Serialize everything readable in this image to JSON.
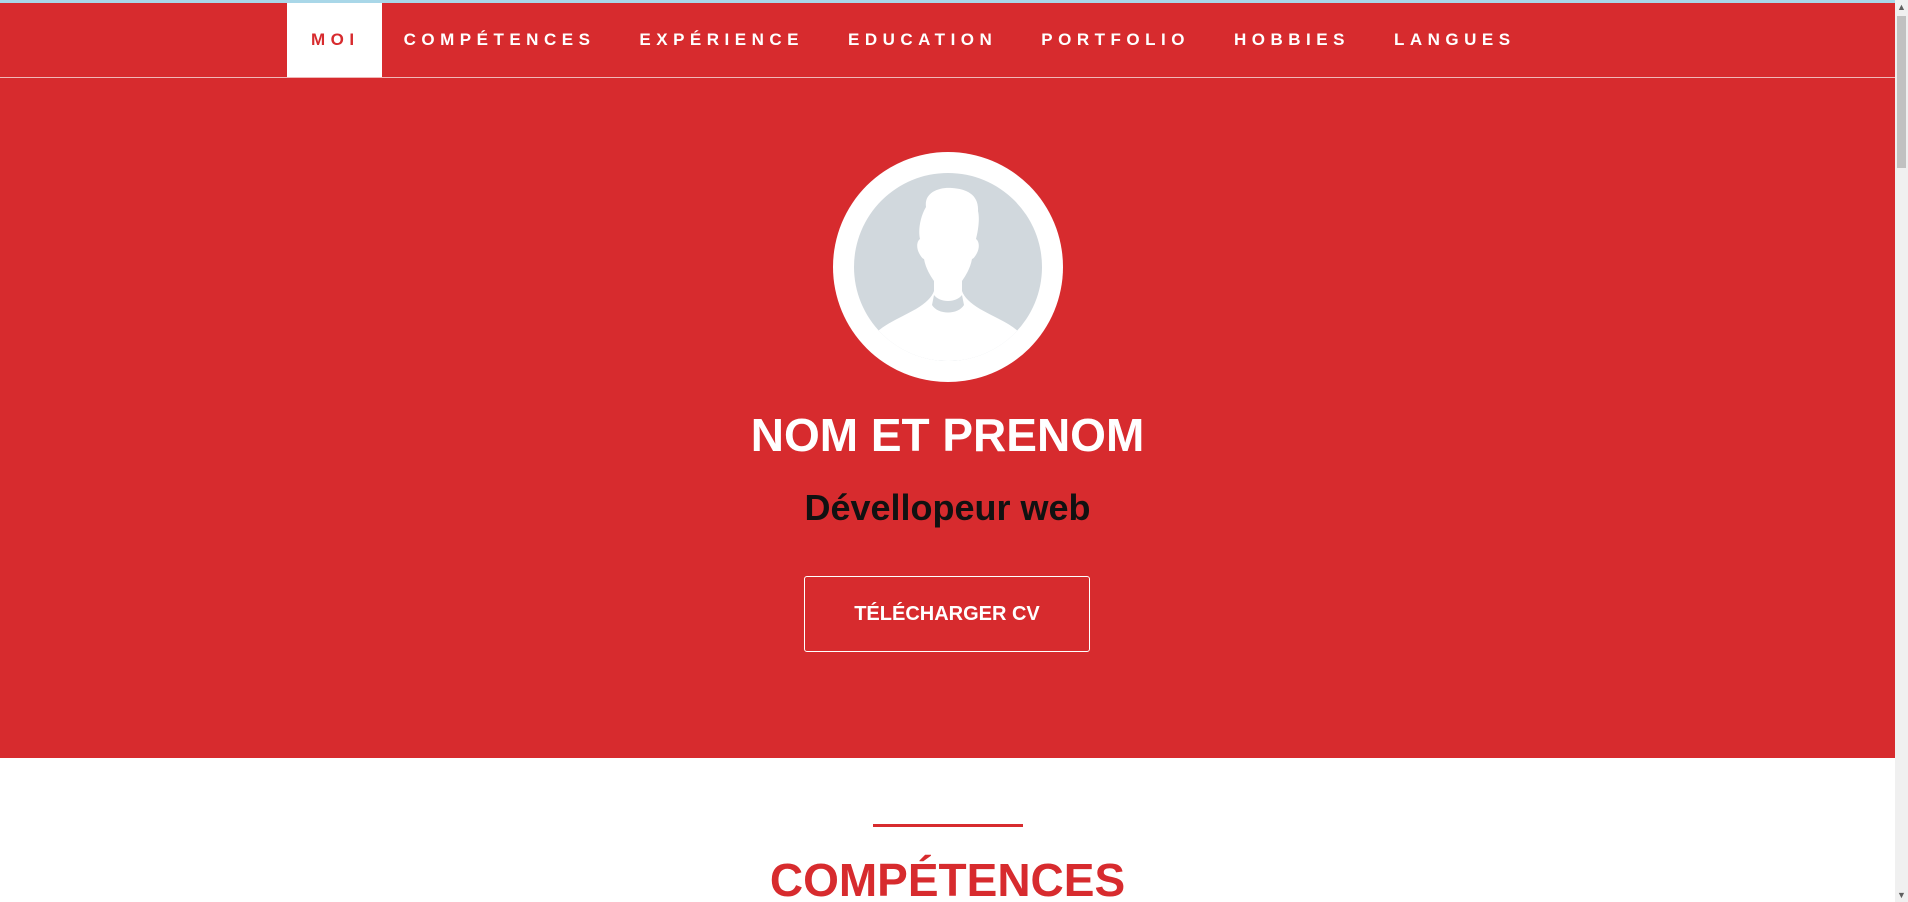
{
  "nav": {
    "items": [
      {
        "label": "MOI",
        "active": true
      },
      {
        "label": "COMPÉTENCES",
        "active": false
      },
      {
        "label": "EXPÉRIENCE",
        "active": false
      },
      {
        "label": "EDUCATION",
        "active": false
      },
      {
        "label": "PORTFOLIO",
        "active": false
      },
      {
        "label": "HOBBIES",
        "active": false
      },
      {
        "label": "LANGUES",
        "active": false
      }
    ]
  },
  "hero": {
    "avatar_icon": "user-silhouette-icon",
    "name": "NOM ET PRENOM",
    "title": "Dévellopeur web",
    "cv_button_label": "TÉLÉCHARGER CV"
  },
  "next_section": {
    "title": "COMPÉTENCES"
  },
  "colors": {
    "accent": "#d72b2e",
    "white": "#ffffff",
    "avatar_bg": "#d1d8dd"
  }
}
